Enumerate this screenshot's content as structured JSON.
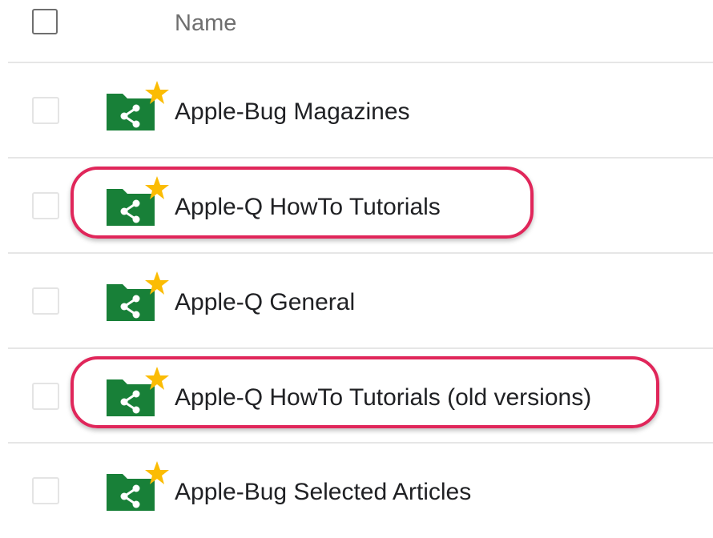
{
  "header": {
    "name_label": "Name"
  },
  "rows": [
    {
      "label": "Apple-Bug Magazines",
      "starred": true,
      "highlighted": false
    },
    {
      "label": "Apple-Q HowTo Tutorials",
      "starred": true,
      "highlighted": true
    },
    {
      "label": "Apple-Q General",
      "starred": true,
      "highlighted": false
    },
    {
      "label": "Apple-Q HowTo Tutorials (old versions)",
      "starred": true,
      "highlighted": true
    },
    {
      "label": "Apple-Bug Selected Articles",
      "starred": true,
      "highlighted": false
    }
  ],
  "colors": {
    "folder_green": "#188038",
    "star_yellow": "#fbbc04",
    "highlight_red": "#e0265a",
    "divider": "#e6e6e6"
  },
  "icons": {
    "folder": "shared-folder-icon",
    "star": "star-icon",
    "share": "share-icon"
  }
}
